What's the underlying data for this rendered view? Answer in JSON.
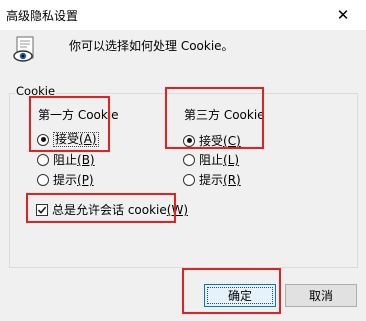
{
  "window": {
    "title": "高级隐私设置",
    "close_glyph": "✕"
  },
  "intro_text": "你可以选择如何处理 Cookie。",
  "group_label": "Cookie",
  "first_party": {
    "title": "第一方 Cookie",
    "options": [
      {
        "label": "接受",
        "accel": "(A)",
        "selected": true
      },
      {
        "label": "阻止",
        "accel": "(B)",
        "selected": false
      },
      {
        "label": "提示",
        "accel": "(P)",
        "selected": false
      }
    ]
  },
  "third_party": {
    "title": "第三方 Cookie",
    "options": [
      {
        "label": "接受",
        "accel": "(C)",
        "selected": true
      },
      {
        "label": "阻止",
        "accel": "(L)",
        "selected": false
      },
      {
        "label": "提示",
        "accel": "(R)",
        "selected": false
      }
    ]
  },
  "session_cookies": {
    "label": "总是允许会话 cookie",
    "accel": "(W)",
    "checked": true
  },
  "buttons": {
    "ok": "确定",
    "cancel": "取消"
  },
  "icons": {
    "header": "privacy-eye-document-icon",
    "checkmark": "✓"
  },
  "colors": {
    "highlight": "#e52020",
    "accent": "#0078d7"
  }
}
